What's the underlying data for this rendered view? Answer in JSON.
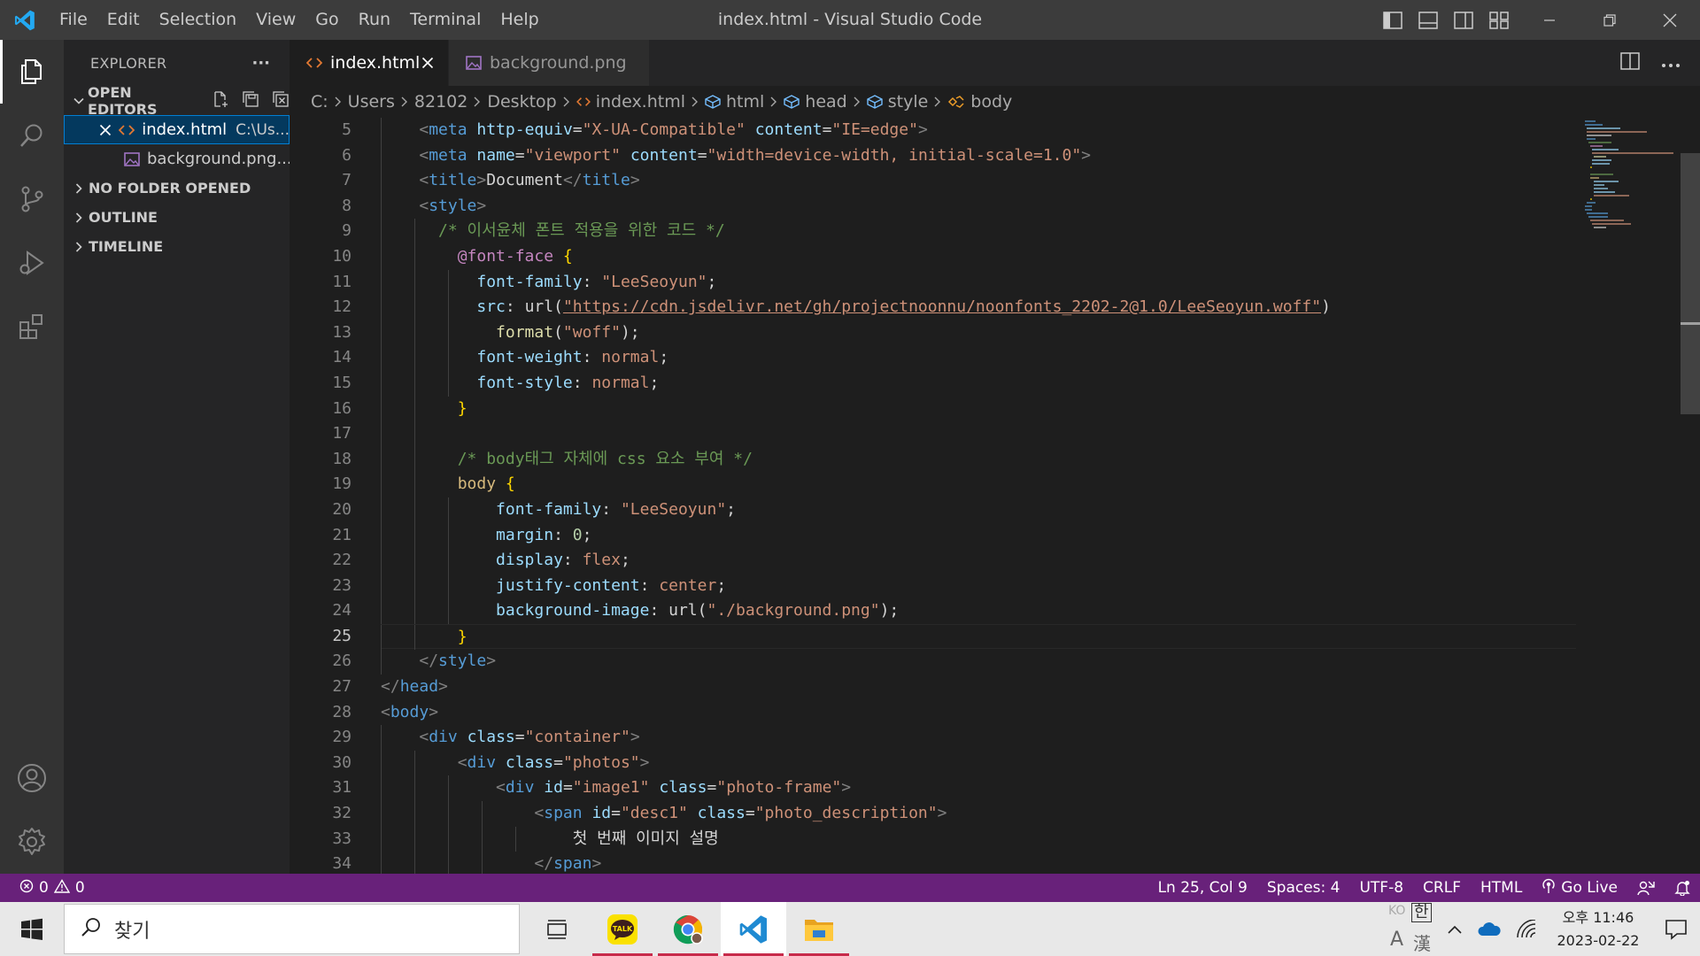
{
  "window": {
    "title": "index.html - Visual Studio Code",
    "menu": [
      "File",
      "Edit",
      "Selection",
      "View",
      "Go",
      "Run",
      "Terminal",
      "Help"
    ]
  },
  "sidebar": {
    "title": "EXPLORER",
    "more": "···",
    "sections": {
      "open_editors": "OPEN EDITORS",
      "no_folder": "NO FOLDER OPENED",
      "outline": "OUTLINE",
      "timeline": "TIMELINE"
    },
    "open_editors": [
      {
        "name": "index.html",
        "desc": "C:\\Us...",
        "icon": "html-icon"
      },
      {
        "name": "background.png...",
        "desc": "",
        "icon": "image-icon"
      }
    ]
  },
  "tabs": [
    {
      "label": "index.html",
      "icon": "html-icon"
    },
    {
      "label": "background.png",
      "icon": "image-icon"
    }
  ],
  "breadcrumb": {
    "drive": "C:",
    "users": "Users",
    "user": "82102",
    "desktop": "Desktop",
    "file": "index.html",
    "s1": "html",
    "s2": "head",
    "s3": "style",
    "s4": "body"
  },
  "code": {
    "line_numbers": [
      "5",
      "6",
      "7",
      "8",
      "9",
      "10",
      "11",
      "12",
      "13",
      "14",
      "15",
      "16",
      "17",
      "18",
      "19",
      "20",
      "21",
      "22",
      "23",
      "24",
      "25",
      "26",
      "27",
      "28",
      "29",
      "30",
      "31",
      "32",
      "33",
      "34"
    ],
    "current_line": "25",
    "l5": {
      "tag": "meta",
      "a1": "http-equiv",
      "v1": "\"X-UA-Compatible\"",
      "a2": "content",
      "v2": "\"IE=edge\""
    },
    "l6": {
      "tag": "meta",
      "a1": "name",
      "v1": "\"viewport\"",
      "a2": "content",
      "v2": "\"width=device-width, initial-scale=1.0\""
    },
    "l7": {
      "tag": "title",
      "text": "Document",
      "close": "title"
    },
    "l8": {
      "tag": "style"
    },
    "l9": {
      "comment": "/* 이서윤체 폰트 적용을 위한 코드 */"
    },
    "l10": {
      "at": "@font-face",
      "brace": "{"
    },
    "l11": {
      "prop": "font-family",
      "val": "\"LeeSeoyun\""
    },
    "l12": {
      "prop": "src",
      "fn": "url",
      "url": "\"https://cdn.jsdelivr.net/gh/projectnoonnu/noonfonts_2202-2@1.0/LeeSeoyun.woff\""
    },
    "l13": {
      "fn": "format",
      "val": "\"woff\""
    },
    "l14": {
      "prop": "font-weight",
      "val": "normal"
    },
    "l15": {
      "prop": "font-style",
      "val": "normal"
    },
    "l16": {
      "brace": "}"
    },
    "l18": {
      "comment": "/* body태그 자체에 css 요소 부여 */"
    },
    "l19": {
      "sel": "body",
      "brace": "{"
    },
    "l20": {
      "prop": "font-family",
      "val": "\"LeeSeoyun\""
    },
    "l21": {
      "prop": "margin",
      "val": "0"
    },
    "l22": {
      "prop": "display",
      "val": "flex"
    },
    "l23": {
      "prop": "justify-content",
      "val": "center"
    },
    "l24": {
      "prop": "background-image",
      "fn": "url",
      "val": "\"./background.png\""
    },
    "l25": {
      "brace": "}"
    },
    "l26": {
      "close": "style"
    },
    "l27": {
      "close": "head"
    },
    "l28": {
      "tag": "body"
    },
    "l29": {
      "tag": "div",
      "a1": "class",
      "v1": "\"container\""
    },
    "l30": {
      "tag": "div",
      "a1": "class",
      "v1": "\"photos\""
    },
    "l31": {
      "tag": "div",
      "a1": "id",
      "v1": "\"image1\"",
      "a2": "class",
      "v2": "\"photo-frame\""
    },
    "l32": {
      "tag": "span",
      "a1": "id",
      "v1": "\"desc1\"",
      "a2": "class",
      "v2": "\"photo_description\""
    },
    "l33": {
      "text": "첫 번째 이미지 설명"
    },
    "l34": {
      "close": "span"
    }
  },
  "status": {
    "errors": "0",
    "warnings": "0",
    "position": "Ln 25, Col 9",
    "spaces": "Spaces: 4",
    "encoding": "UTF-8",
    "eol": "CRLF",
    "language": "HTML",
    "golive": "Go Live"
  },
  "taskbar": {
    "search_label": "찾기",
    "ime_ko": "KO",
    "ime_han": "한",
    "ime_a": "A",
    "ime_hanja": "漢",
    "time": "오후 11:46",
    "date": "2023-02-22",
    "kakao_label": "TALK"
  },
  "colors": {
    "statusbar": "#68217a",
    "activitybar": "#333333",
    "sidebar": "#252526",
    "editor": "#1e1e1e",
    "accent": "#007acc"
  }
}
